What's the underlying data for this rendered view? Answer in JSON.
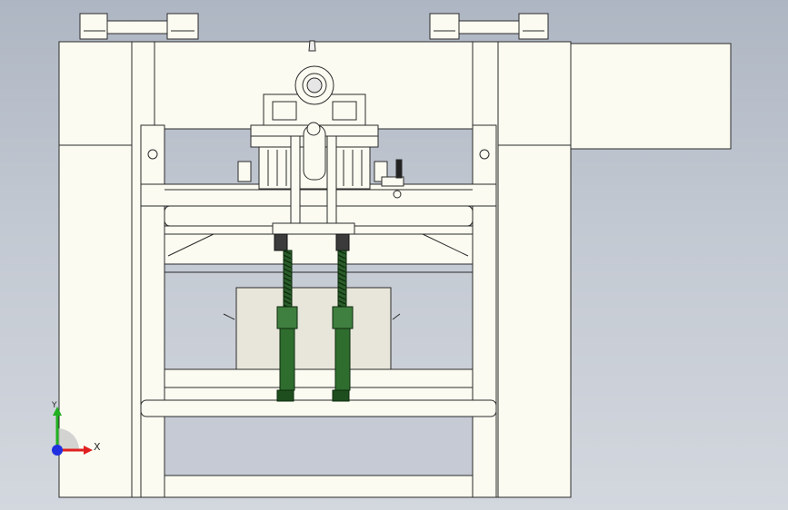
{
  "triad": {
    "x_label": "X",
    "y_label": "Y"
  },
  "colors": {
    "background_top": "#aeb6c3",
    "background_bottom": "#d3d7de",
    "part_fill": "#fbfbf1",
    "part_edge": "#2b2b2b",
    "block_fill": "#e8e6da",
    "spring": "#2a5d2a",
    "rod": "#2f6d2f",
    "axis_x": "#e02020",
    "axis_y": "#20b020",
    "axis_z": "#2030e0"
  }
}
